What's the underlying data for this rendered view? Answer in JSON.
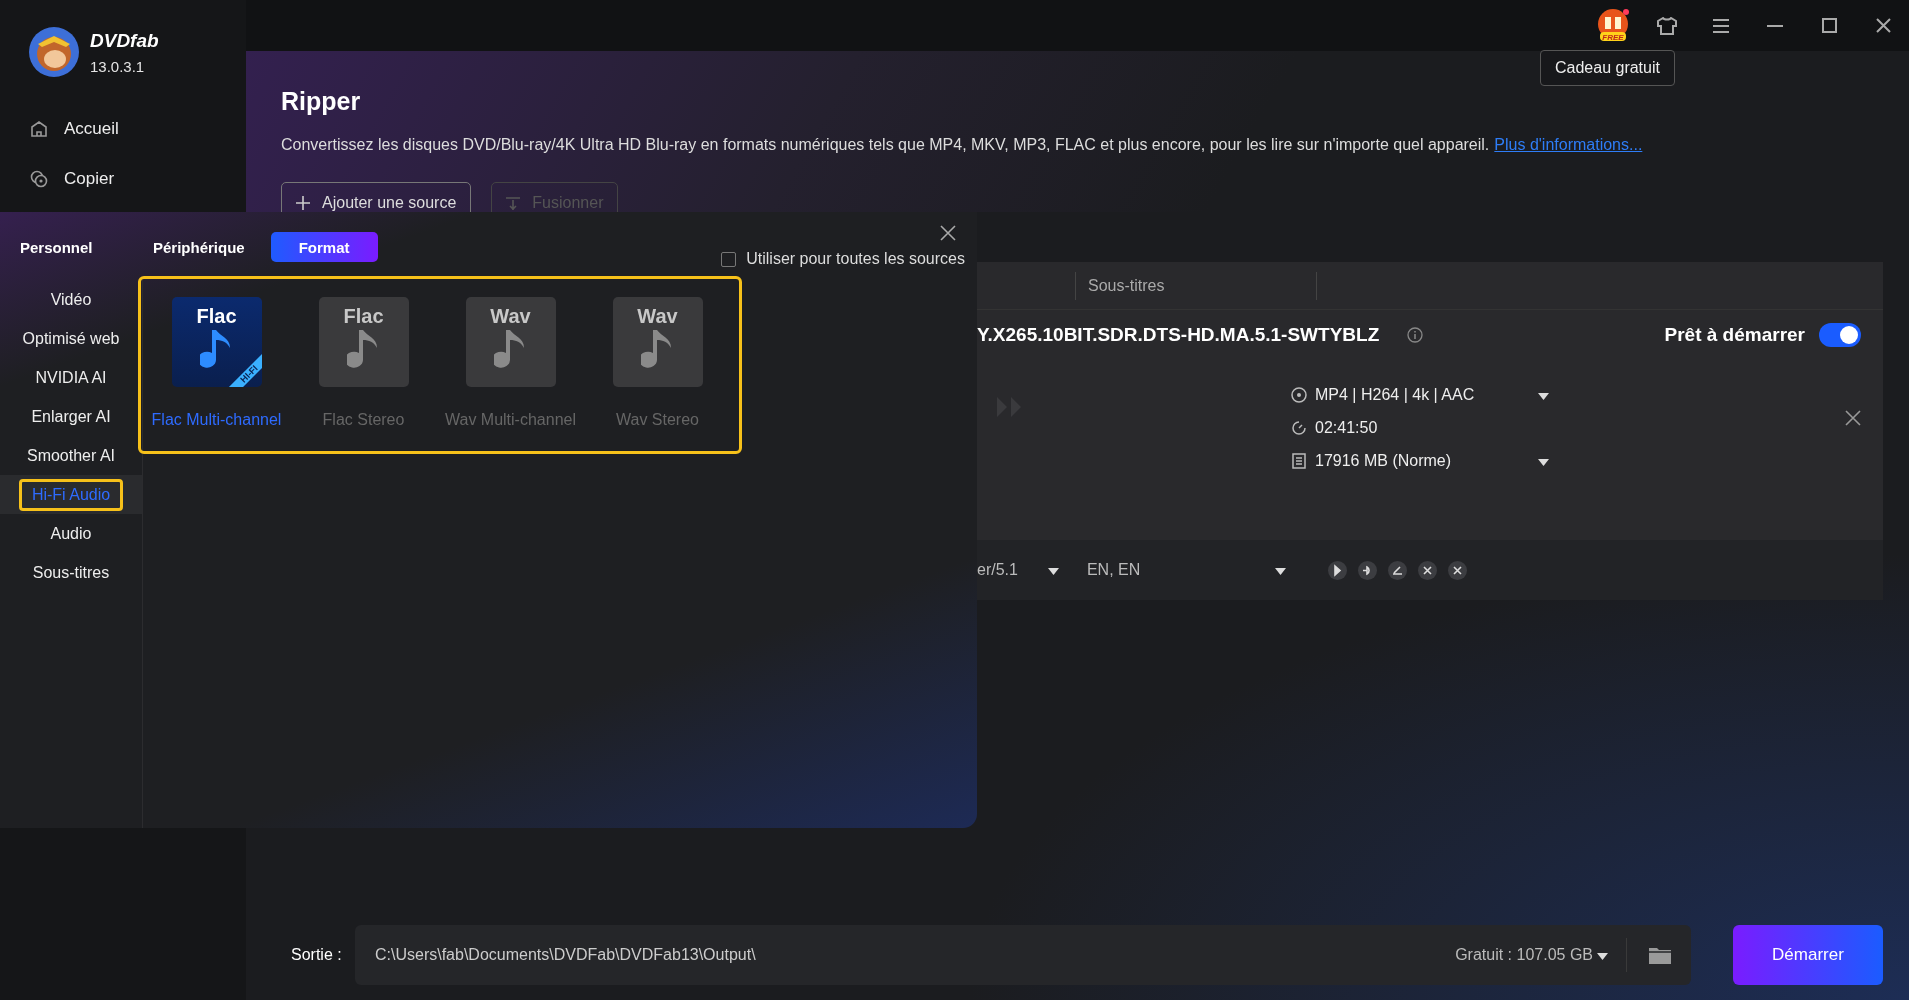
{
  "app": {
    "name": "DVDfab",
    "version": "13.0.3.1"
  },
  "sidebar": {
    "items": [
      {
        "label": "Accueil"
      },
      {
        "label": "Copier"
      }
    ]
  },
  "top_bar": {
    "tooltip": "Cadeau gratuit",
    "gift_badge": "FREE"
  },
  "header": {
    "title": "Ripper",
    "description": "Convertissez les disques DVD/Blu-ray/4K Ultra HD Blu-ray en formats numériques tels que MP4, MKV, MP3, FLAC et plus encore, pour les lire sur n'importe quel appareil.",
    "link": "Plus d'informations...",
    "buttons": [
      {
        "label": "Ajouter une source",
        "disabled": false
      },
      {
        "label": "Fusionner",
        "disabled": true
      }
    ]
  },
  "task": {
    "columns": [
      "Sous-titres"
    ],
    "title": "Y.X265.10BIT.SDR.DTS-HD.MA.5.1-SWTYBLZ",
    "status": "Prêt à démarrer",
    "on": true,
    "details": [
      {
        "text": "MP4 | H264 | 4k | AAC",
        "dropdown": true
      },
      {
        "text": "02:41:50",
        "dropdown": false
      },
      {
        "text": "17916 MB (Norme)",
        "dropdown": true
      }
    ],
    "tracks": [
      {
        "text": "er/5.1"
      },
      {
        "text": "EN, EN"
      }
    ]
  },
  "popup": {
    "tabs": [
      {
        "label": "Personnel",
        "selected": false
      },
      {
        "label": "Périphérique",
        "selected": false
      },
      {
        "label": "Format",
        "selected": true
      }
    ],
    "apply_all": {
      "label": "Utiliser pour toutes les sources",
      "checked": false
    },
    "categories": [
      {
        "label": "Vidéo",
        "selected": false
      },
      {
        "label": "Optimisé web",
        "selected": false
      },
      {
        "label": "NVIDIA AI",
        "selected": false
      },
      {
        "label": "Enlarger AI",
        "selected": false
      },
      {
        "label": "Smoother AI",
        "selected": false
      },
      {
        "label": "Hi-Fi Audio",
        "selected": true
      },
      {
        "label": "Audio",
        "selected": false
      },
      {
        "label": "Sous-titres",
        "selected": false
      }
    ],
    "formats": [
      {
        "badge": "Flac",
        "ribbon": "HI-FI",
        "label": "Flac Multi-channel",
        "selected": true
      },
      {
        "badge": "Flac",
        "label": "Flac Stereo",
        "selected": false
      },
      {
        "badge": "Wav",
        "label": "Wav Multi-channel",
        "selected": false
      },
      {
        "badge": "Wav",
        "label": "Wav Stereo",
        "selected": false
      }
    ]
  },
  "output": {
    "label": "Sortie :",
    "path": "C:\\Users\\fab\\Documents\\DVDFab\\DVDFab13\\Output\\",
    "free_space": "Gratuit : 107.05 GB",
    "start": "Démarrer"
  }
}
